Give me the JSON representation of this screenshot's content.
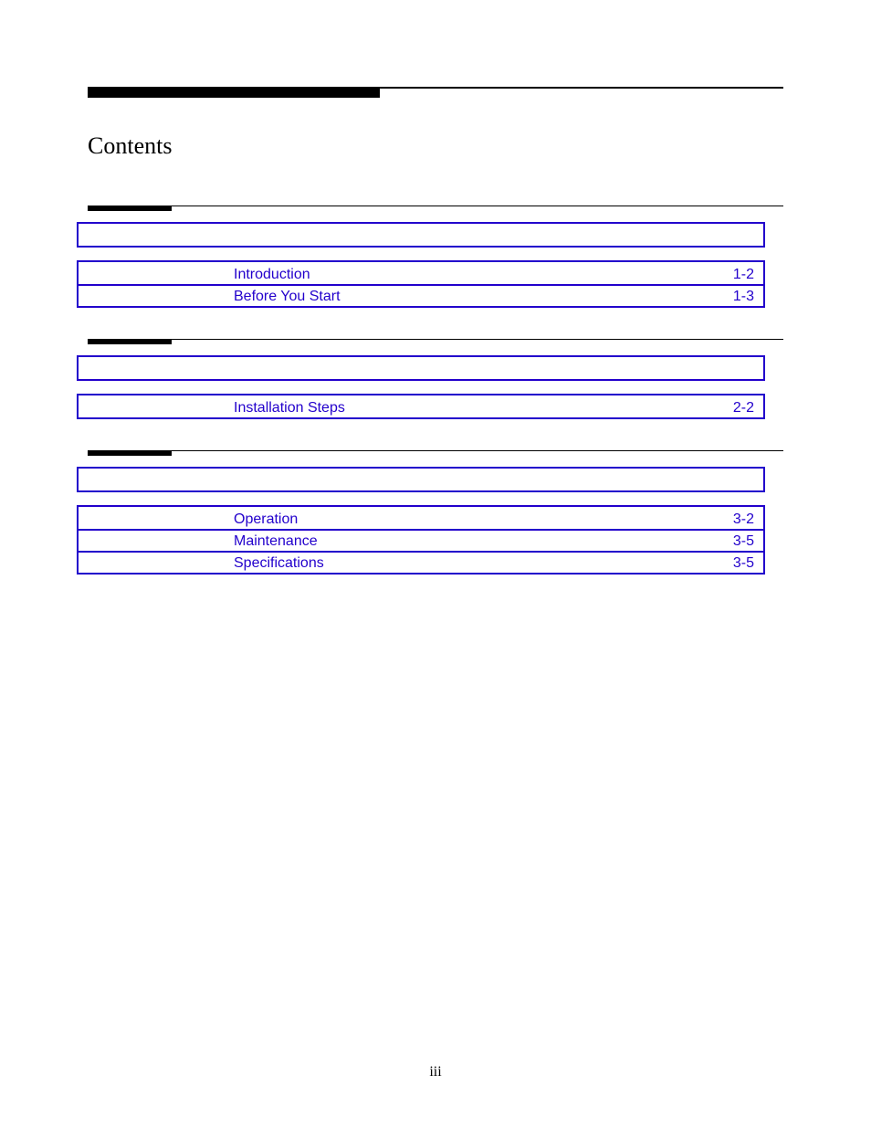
{
  "title": "Contents",
  "footer": "iii",
  "sections": [
    {
      "entries": [
        {
          "label": "Introduction",
          "page": "1-2"
        },
        {
          "label": "Before You Start",
          "page": "1-3"
        }
      ]
    },
    {
      "entries": [
        {
          "label": "Installation Steps",
          "page": "2-2"
        }
      ]
    },
    {
      "entries": [
        {
          "label": "Operation",
          "page": "3-2"
        },
        {
          "label": "Maintenance",
          "page": "3-5"
        },
        {
          "label": "Specifications",
          "page": "3-5"
        }
      ]
    }
  ]
}
